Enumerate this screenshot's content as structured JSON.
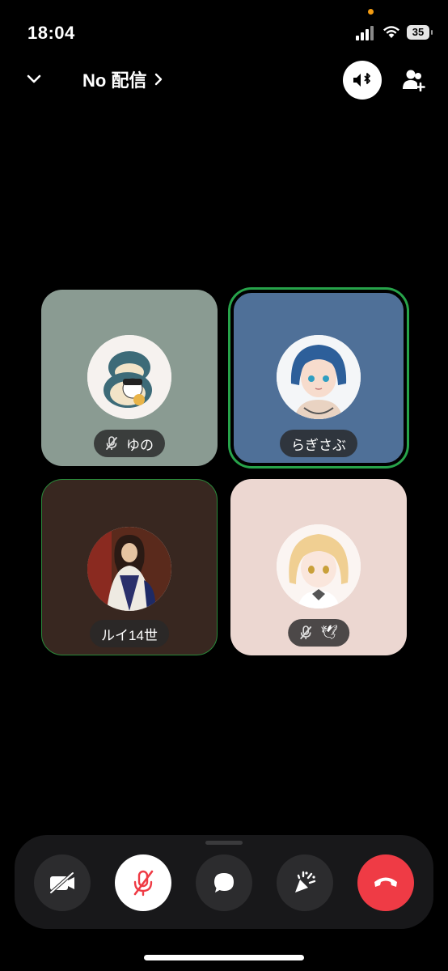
{
  "status_bar": {
    "time": "18:04",
    "battery": "35",
    "icons": [
      "signal-icon",
      "wifi-icon",
      "battery-icon"
    ]
  },
  "header": {
    "channel_name": "No 配信",
    "icons": [
      "chevron-down-icon",
      "chevron-right-icon",
      "speaker-bluetooth-icon",
      "add-person-icon"
    ]
  },
  "participants": [
    {
      "name": "ゆの",
      "muted": true,
      "speaking": false,
      "tile_color": "#8a9b92"
    },
    {
      "name": "らぎさぶ",
      "muted": false,
      "speaking": true,
      "tile_color": "#4f7098"
    },
    {
      "name": "ルイ14世",
      "muted": false,
      "speaking": false,
      "tile_color": "#382720"
    },
    {
      "name": "🕊",
      "muted": true,
      "speaking": false,
      "tile_color": "#ecd7d1"
    }
  ],
  "controls": [
    "camera-off-icon",
    "mic-muted-icon",
    "chat-bubble-icon",
    "activity-icon",
    "hang-up-icon"
  ],
  "colors": {
    "speaking_ring": "#27a34a",
    "hang_up": "#ef3b45",
    "mute_slash": "#ef3b45"
  }
}
